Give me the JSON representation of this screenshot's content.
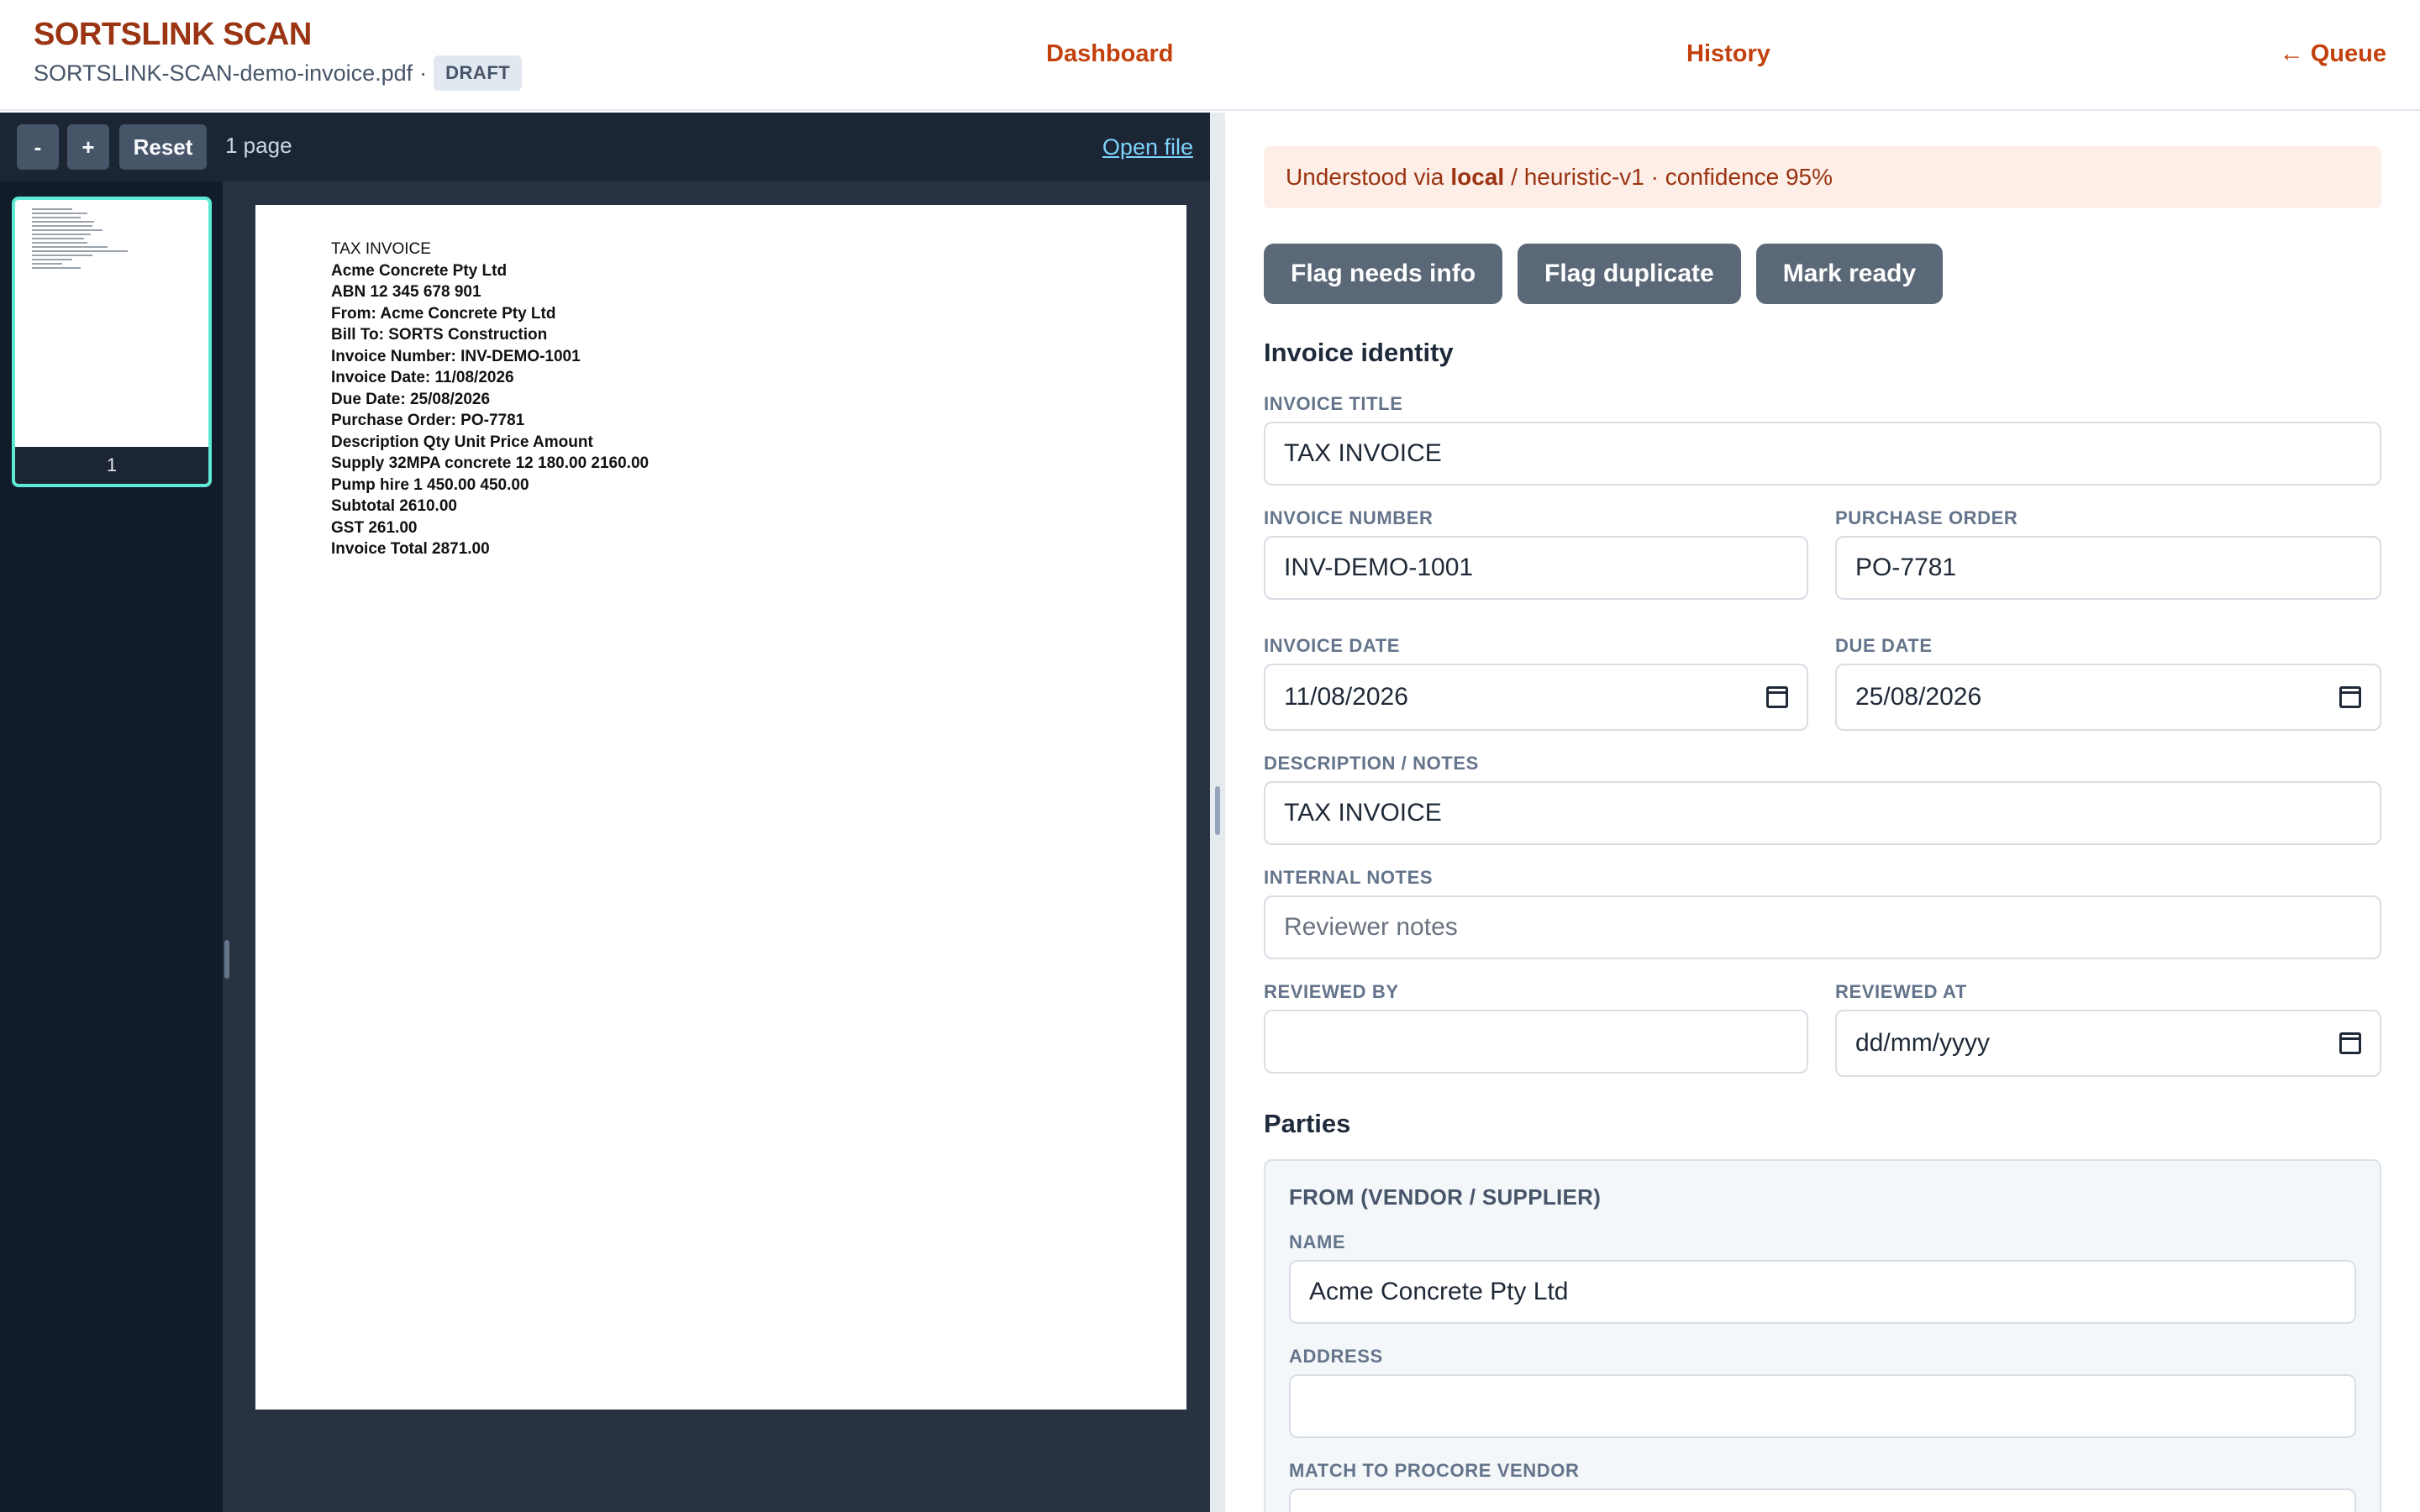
{
  "header": {
    "brand": "SORTSLINK SCAN",
    "filename": "SORTSLINK-SCAN-demo-invoice.pdf",
    "separator": "·",
    "status_badge": "DRAFT",
    "nav": {
      "dashboard": "Dashboard",
      "history": "History",
      "queue": "← Queue"
    }
  },
  "viewer": {
    "zoom_out_label": "-",
    "zoom_in_label": "+",
    "reset_label": "Reset",
    "page_count": "1 page",
    "open_file_label": "Open file",
    "thumbnails": [
      {
        "page": "1"
      }
    ],
    "document_lines": [
      "TAX INVOICE",
      "Acme Concrete Pty Ltd",
      "ABN 12 345 678 901",
      "From: Acme Concrete Pty Ltd",
      "Bill To: SORTS Construction",
      "Invoice Number: INV-DEMO-1001",
      "Invoice Date: 11/08/2026",
      "Due Date: 25/08/2026",
      "Purchase Order: PO-7781",
      "Description Qty Unit Price Amount",
      "Supply 32MPA concrete 12 180.00 2160.00",
      "Pump hire 1 450.00 450.00",
      "Subtotal 2610.00",
      "GST 261.00",
      "Invoice Total 2871.00"
    ]
  },
  "panel": {
    "notice": {
      "prefix": "Understood via",
      "engine": "local",
      "suffix": "/ heuristic-v1 · confidence 95%"
    },
    "actions": {
      "flag_needs_info": "Flag needs info",
      "flag_duplicate": "Flag duplicate",
      "mark_ready": "Mark ready"
    },
    "identity": {
      "title": "Invoice identity",
      "invoice_title_label": "INVOICE TITLE",
      "invoice_title_value": "TAX INVOICE",
      "invoice_number_label": "INVOICE NUMBER",
      "invoice_number_value": "INV-DEMO-1001",
      "purchase_order_label": "PURCHASE ORDER",
      "purchase_order_value": "PO-7781",
      "invoice_date_label": "INVOICE DATE",
      "invoice_date_value": "11/08/2026",
      "due_date_label": "DUE DATE",
      "due_date_value": "25/08/2026",
      "description_label": "DESCRIPTION / NOTES",
      "description_value": "TAX INVOICE",
      "internal_notes_label": "INTERNAL NOTES",
      "internal_notes_placeholder": "Reviewer notes",
      "reviewed_by_label": "REVIEWED BY",
      "reviewed_by_value": "",
      "reviewed_at_label": "REVIEWED AT",
      "reviewed_at_placeholder": "dd/mm/yyyy"
    },
    "parties": {
      "title": "Parties",
      "from_heading": "FROM (VENDOR / SUPPLIER)",
      "name_label": "NAME",
      "name_value": "Acme Concrete Pty Ltd",
      "address_label": "ADDRESS",
      "address_value": "",
      "match_label": "MATCH TO PROCORE VENDOR"
    }
  },
  "colors": {
    "brand": "#9a3412",
    "nav_link": "#c2410c",
    "viewer_bg": "#283241",
    "thumb_highlight": "#5eead4",
    "action_button": "#5b6878",
    "notice_bg": "#fdeee7"
  }
}
